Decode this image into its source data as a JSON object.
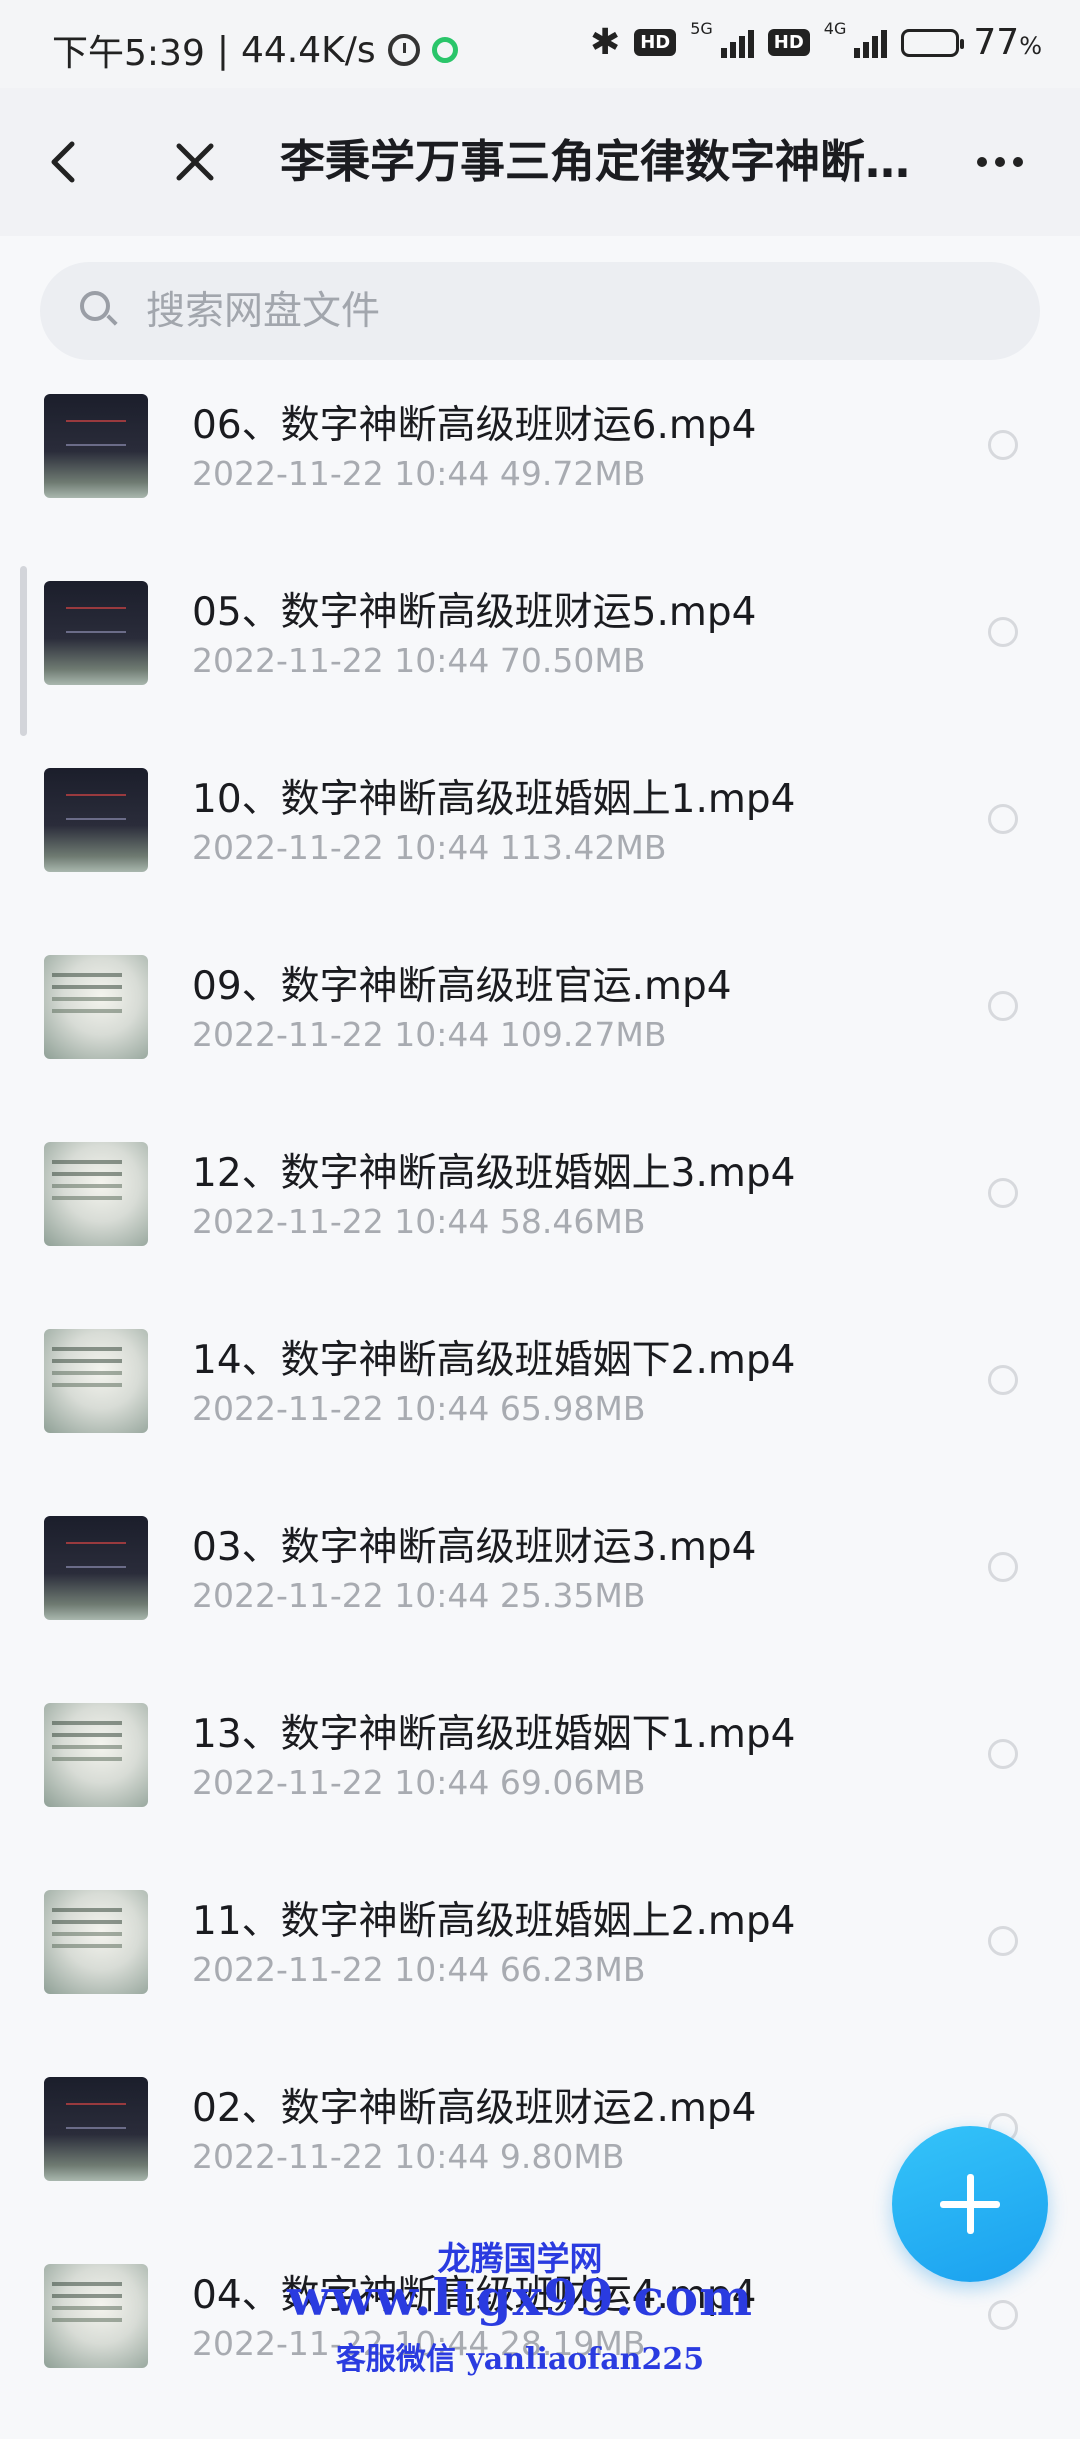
{
  "status_bar": {
    "time": "下午5:39",
    "net_speed": "44.4K/s",
    "network_5g": "5G",
    "network_4g": "4G",
    "hd1": "HD",
    "hd2": "HD",
    "battery": "77",
    "battery_unit": "%",
    "battery_level": 0.77
  },
  "header": {
    "title": "李秉学万事三角定律数字神断…"
  },
  "search": {
    "placeholder": "搜索网盘文件"
  },
  "files": [
    {
      "name": "06、数字神断高级班财运6.mp4",
      "date": "2022-11-22",
      "time": "10:44",
      "size": "49.72MB",
      "thumb": "dark"
    },
    {
      "name": "05、数字神断高级班财运5.mp4",
      "date": "2022-11-22",
      "time": "10:44",
      "size": "70.50MB",
      "thumb": "dark"
    },
    {
      "name": "10、数字神断高级班婚姻上1.mp4",
      "date": "2022-11-22",
      "time": "10:44",
      "size": "113.42MB",
      "thumb": "dark"
    },
    {
      "name": "09、数字神断高级班官运.mp4",
      "date": "2022-11-22",
      "time": "10:44",
      "size": "109.27MB",
      "thumb": "light"
    },
    {
      "name": "12、数字神断高级班婚姻上3.mp4",
      "date": "2022-11-22",
      "time": "10:44",
      "size": "58.46MB",
      "thumb": "light"
    },
    {
      "name": "14、数字神断高级班婚姻下2.mp4",
      "date": "2022-11-22",
      "time": "10:44",
      "size": "65.98MB",
      "thumb": "light"
    },
    {
      "name": "03、数字神断高级班财运3.mp4",
      "date": "2022-11-22",
      "time": "10:44",
      "size": "25.35MB",
      "thumb": "dark"
    },
    {
      "name": "13、数字神断高级班婚姻下1.mp4",
      "date": "2022-11-22",
      "time": "10:44",
      "size": "69.06MB",
      "thumb": "light"
    },
    {
      "name": "11、数字神断高级班婚姻上2.mp4",
      "date": "2022-11-22",
      "time": "10:44",
      "size": "66.23MB",
      "thumb": "light"
    },
    {
      "name": "02、数字神断高级班财运2.mp4",
      "date": "2022-11-22",
      "time": "10:44",
      "size": "9.80MB",
      "thumb": "dark"
    },
    {
      "name": "04、数字神断高级班财运4.mp4",
      "date": "2022-11-22",
      "time": "10:44",
      "size": "28.19MB",
      "thumb": "light"
    }
  ],
  "watermark": {
    "line1": "龙腾国学网",
    "line2": "www.ltgx99.com",
    "line3": "客服微信 yanliaofan225"
  },
  "colors": {
    "accent": "#1aa0ef",
    "watermark": "#2a3be0"
  },
  "icons": [
    "back-icon",
    "close-icon",
    "more-icon",
    "search-icon",
    "plus-icon",
    "alarm-icon",
    "bluetooth-icon",
    "battery-icon"
  ]
}
